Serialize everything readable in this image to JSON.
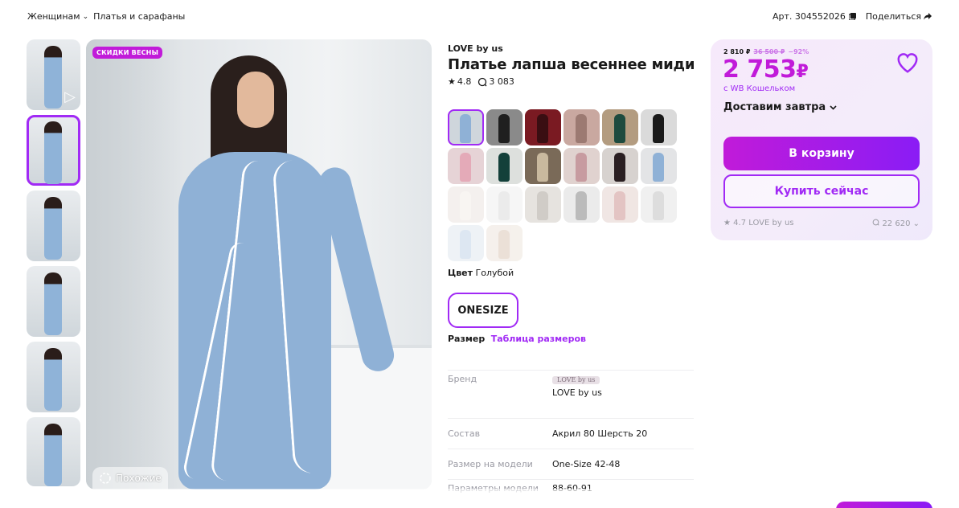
{
  "breadcrumb": {
    "category": "Женщинам",
    "subcategory": "Платья и сарафаны"
  },
  "header": {
    "article": "Арт. 304552026",
    "share": "Поделиться"
  },
  "gallery": {
    "badge": "СКИДКИ ВЕСНЫ",
    "similar": "Похожие"
  },
  "product": {
    "brand": "LOVE by us",
    "title": "Платье лапша весеннее миди",
    "rating": "4.8",
    "reviews": "3 083"
  },
  "color": {
    "label": "Цвет",
    "value": "Голубой"
  },
  "size": {
    "option": "ONESIZE",
    "label": "Размер",
    "table_link": "Таблица размеров"
  },
  "specs": {
    "brand_key": "Бренд",
    "brand_logo": "LOVE by us",
    "brand_value": "LOVE by us",
    "composition_key": "Состав",
    "composition_value": "Акрил 80 Шерсть 20",
    "model_size_key": "Размер на модели",
    "model_size_value": "One-Size 42-48",
    "model_params_key": "Параметры модели",
    "model_params_value": "88-60-91"
  },
  "buybox": {
    "price_wb": "2 810 ₽",
    "price_old": "36 500 ₽",
    "discount": "−92%",
    "price": "2 753",
    "currency": "₽",
    "wallet": "с WB Кошельком",
    "delivery": "Доставим завтра",
    "cart_button": "В корзину",
    "buy_now_button": "Купить сейчас",
    "seller_rating": "4.7",
    "seller_name": "LOVE by us",
    "seller_reviews": "22 620"
  },
  "colors": {
    "brand": "#a12af5",
    "accent": "#c11bd9",
    "dress": "#8fb1d6"
  }
}
